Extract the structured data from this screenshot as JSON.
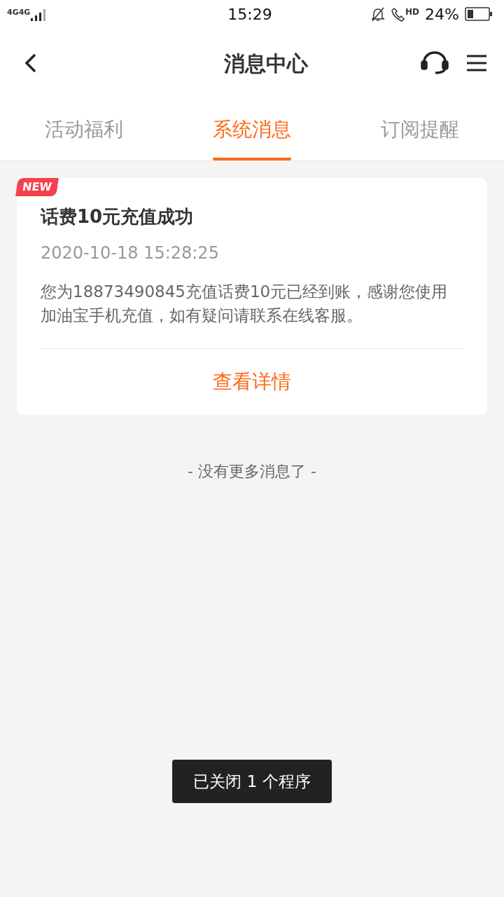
{
  "status_bar": {
    "network_labels": [
      "4G",
      "4G"
    ],
    "time": "15:29",
    "call_label": "HD",
    "battery": "24%"
  },
  "header": {
    "title": "消息中心"
  },
  "tabs": [
    {
      "label": "活动福利",
      "selected": false
    },
    {
      "label": "系统消息",
      "selected": true
    },
    {
      "label": "订阅提醒",
      "selected": false
    }
  ],
  "messages": [
    {
      "badge": "NEW",
      "title": "话费10元充值成功",
      "time": "2020-10-18 15:28:25",
      "body": "您为18873490845充值话费10元已经到账，感谢您使用加油宝手机充值，如有疑问请联系在线客服。",
      "action": "查看详情"
    }
  ],
  "end_note": "- 没有更多消息了 -",
  "toast": "已关闭 1 个程序"
}
